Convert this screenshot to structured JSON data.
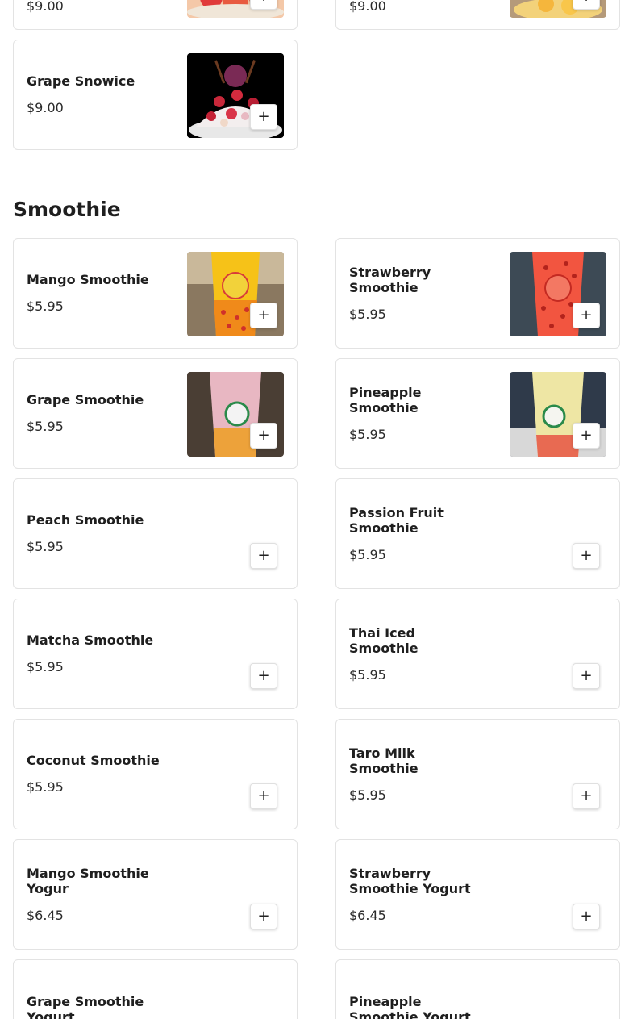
{
  "top_partial": {
    "left": {
      "price": "$9.00"
    },
    "right": {
      "price": "$9.00"
    }
  },
  "snowice": {
    "grape": {
      "name": "Grape Snowice",
      "price": "$9.00"
    }
  },
  "add_icon": "plus-icon",
  "add_glyph": "+",
  "smoothie": {
    "title": "Smoothie",
    "items": [
      {
        "name": "Mango Smoothie",
        "price": "$5.95",
        "image": "mango-smoothie-photo"
      },
      {
        "name": "Strawberry Smoothie",
        "price": "$5.95",
        "image": "strawberry-smoothie-photo"
      },
      {
        "name": "Grape Smoothie",
        "price": "$5.95",
        "image": "grape-smoothie-photo"
      },
      {
        "name": "Pineapple Smoothie",
        "price": "$5.95",
        "image": "pineapple-smoothie-photo"
      },
      {
        "name": "Peach Smoothie",
        "price": "$5.95"
      },
      {
        "name": "Passion Fruit Smoothie",
        "price": "$5.95"
      },
      {
        "name": "Matcha Smoothie",
        "price": "$5.95"
      },
      {
        "name": "Thai Iced Smoothie",
        "price": "$5.95"
      },
      {
        "name": "Coconut Smoothie",
        "price": "$5.95"
      },
      {
        "name": "Taro Milk Smoothie",
        "price": "$5.95"
      },
      {
        "name": "Mango Smoothie Yogur",
        "price": "$6.45"
      },
      {
        "name": "Strawberry Smoothie Yogurt",
        "price": "$6.45"
      },
      {
        "name": "Grape Smoothie Yogurt",
        "price": ""
      },
      {
        "name": "Pineapple Smoothie Yogurt",
        "price": ""
      }
    ]
  }
}
